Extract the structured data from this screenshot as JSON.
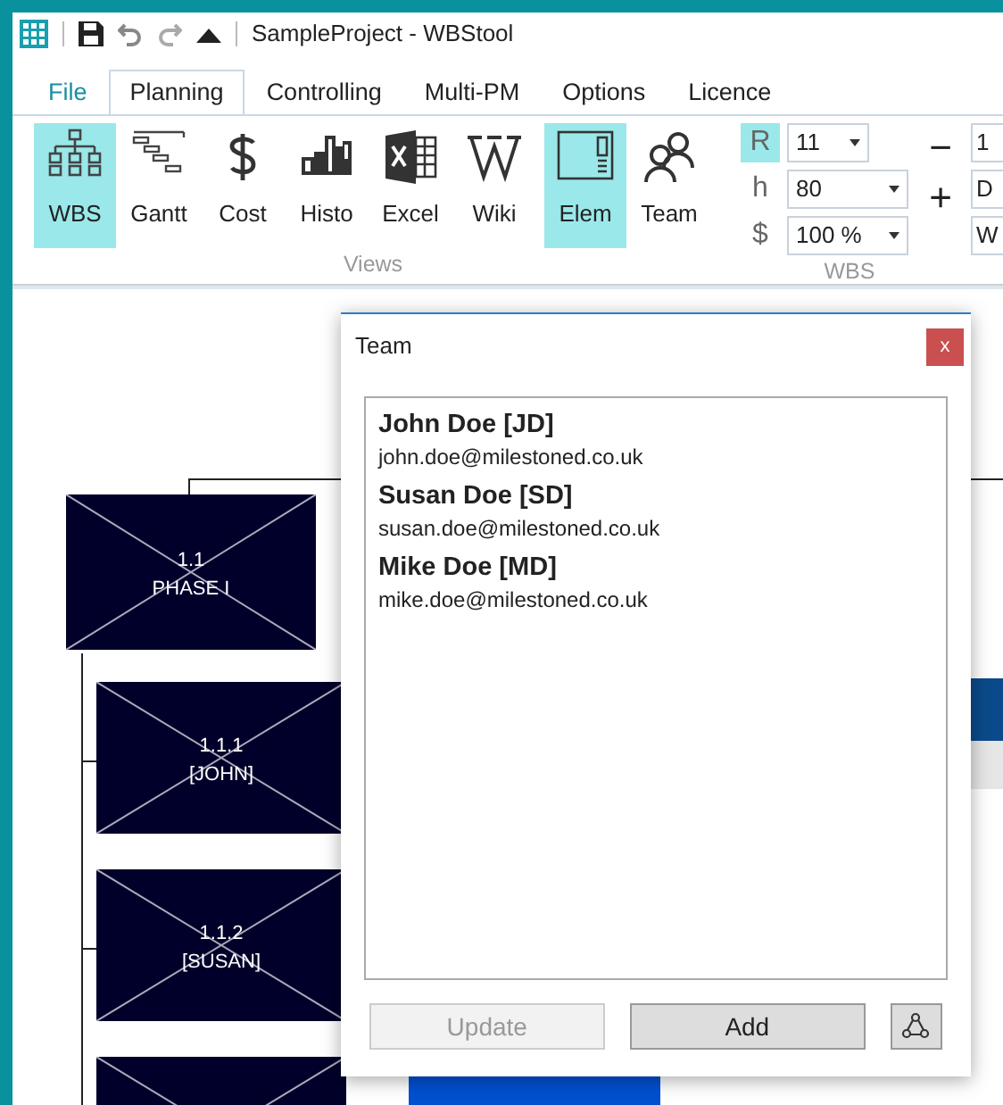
{
  "window": {
    "title": "SampleProject - WBStool"
  },
  "tabs": [
    {
      "label": "File",
      "selected": false,
      "kind": "file"
    },
    {
      "label": "Planning",
      "selected": true,
      "kind": "tab"
    },
    {
      "label": "Controlling",
      "selected": false,
      "kind": "tab"
    },
    {
      "label": "Multi-PM",
      "selected": false,
      "kind": "tab"
    },
    {
      "label": "Options",
      "selected": false,
      "kind": "tab"
    },
    {
      "label": "Licence",
      "selected": false,
      "kind": "tab"
    }
  ],
  "ribbon": {
    "views": {
      "label": "Views",
      "buttons": [
        {
          "label": "WBS",
          "selected": true
        },
        {
          "label": "Gantt",
          "selected": false
        },
        {
          "label": "Cost",
          "selected": false
        },
        {
          "label": "Histo",
          "selected": false
        },
        {
          "label": "Excel",
          "selected": false
        },
        {
          "label": "Wiki",
          "selected": false
        },
        {
          "label": "Elem",
          "selected": true
        },
        {
          "label": "Team",
          "selected": false
        }
      ]
    },
    "wbs": {
      "label": "WBS",
      "rows": [
        {
          "label": "R",
          "value": "11",
          "selected": true
        },
        {
          "label": "h",
          "value": "80",
          "selected": false
        },
        {
          "label": "$",
          "value": "100 %",
          "selected": false
        }
      ],
      "steppers": [
        "−",
        "+"
      ]
    },
    "next_group": {
      "fields": [
        "1",
        "D",
        "W"
      ]
    }
  },
  "canvas": {
    "root": {
      "number": "1.1",
      "label": "PHASE I"
    },
    "children": [
      {
        "number": "1.1.1",
        "label": "[JOHN]"
      },
      {
        "number": "1.1.2",
        "label": "[SUSAN]"
      }
    ]
  },
  "dialog": {
    "title": "Team",
    "close": "x",
    "members": [
      {
        "name": "John Doe [JD]",
        "email": "john.doe@milestoned.co.uk"
      },
      {
        "name": "Susan Doe [SD]",
        "email": "susan.doe@milestoned.co.uk"
      },
      {
        "name": "Mike Doe [MD]",
        "email": "mike.doe@milestoned.co.uk"
      }
    ],
    "buttons": [
      {
        "label": "Update",
        "disabled": true
      },
      {
        "label": "Add",
        "disabled": false
      }
    ]
  }
}
